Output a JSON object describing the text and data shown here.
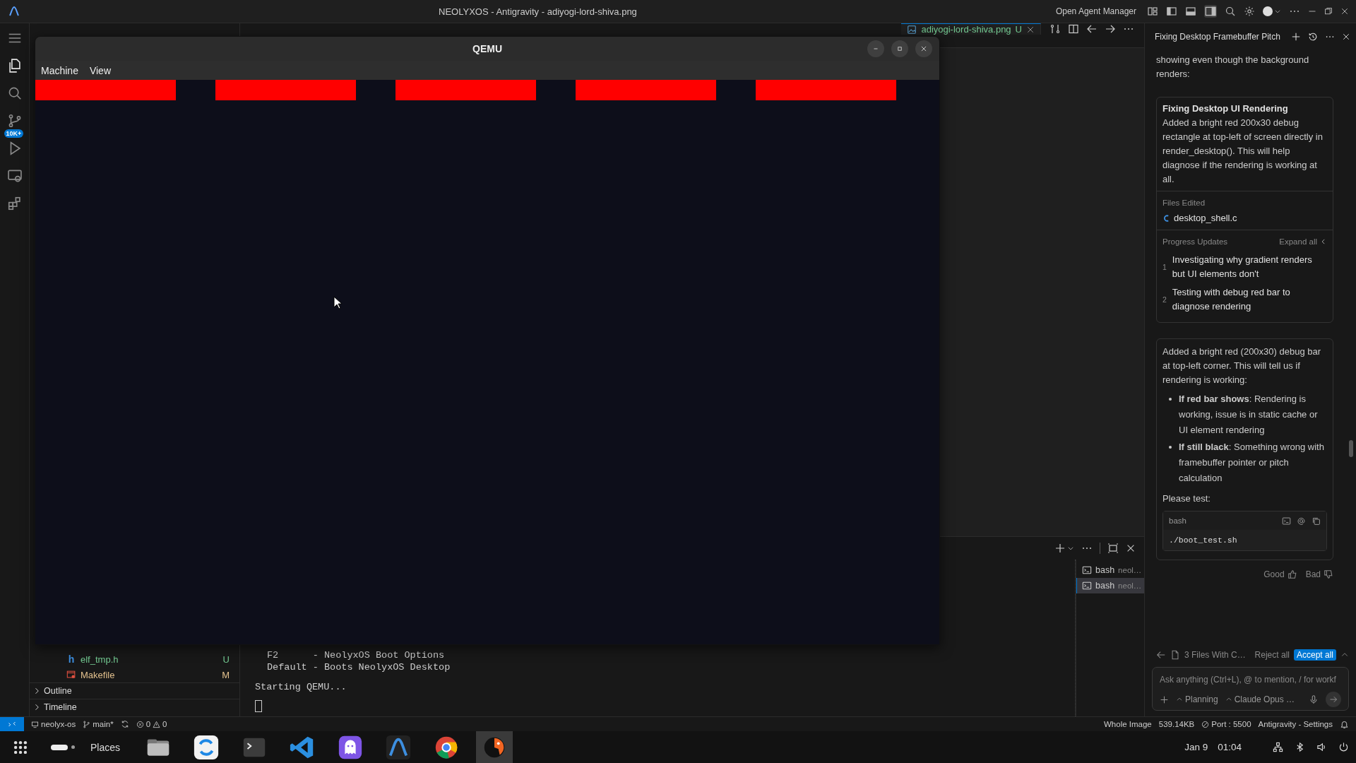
{
  "title_bar": {
    "title": "NEOLYXOS - Antigravity - adiyogi-lord-shiva.png",
    "agent_manager": "Open Agent Manager"
  },
  "activity_bar": {
    "badge": "10K+"
  },
  "editor_tabs": [
    {
      "label": "adiyogi-lord-shiva.png",
      "status": "U",
      "selected": true
    }
  ],
  "explorer": {
    "files": [
      {
        "name": "elf_tmp.h",
        "status": "U",
        "color": "#73c991",
        "kind": "header",
        "glyph": "h"
      },
      {
        "name": "Makefile",
        "status": "M",
        "color": "#e2c08d",
        "kind": "makefile"
      }
    ],
    "sections": [
      {
        "label": "Outline",
        "expanded": false
      },
      {
        "label": "Timeline",
        "expanded": false
      }
    ]
  },
  "qemu": {
    "title": "QEMU",
    "menu": [
      "Machine",
      "View"
    ]
  },
  "terminal": {
    "boot_menu": [
      "F2      - NeolyxOS Boot Options",
      "Default - Boots NeolyxOS Desktop"
    ],
    "status_line": "Starting QEMU...",
    "sessions": [
      {
        "name": "bash",
        "detail": "neol…",
        "selected": false
      },
      {
        "name": "bash",
        "detail": "neol…",
        "selected": true
      }
    ]
  },
  "chat": {
    "title": "Fixing Desktop Framebuffer Pitch",
    "intro": "showing even though the background renders:",
    "task": {
      "title": "Fixing Desktop UI Rendering",
      "summary": "Added a bright red 200x30 debug rectangle at top-left of screen directly in render_desktop(). This will help diagnose if the rendering is working at all.",
      "files_heading": "Files Edited",
      "files": [
        "desktop_shell.c"
      ],
      "progress_heading": "Progress Updates",
      "expand": "Expand all",
      "steps": [
        {
          "number": "1",
          "text": "Investigating why gradient renders but UI elements don't"
        },
        {
          "number": "2",
          "text": "Testing with debug red bar to diagnose rendering"
        }
      ]
    },
    "reply": {
      "text": "Added a bright red (200x30) debug bar at top-left corner. This will tell us if rendering is working:",
      "bullets": [
        "**If red bar shows**: Rendering is working, issue is in static cache or UI element rendering",
        "**If still black**: Something wrong with framebuffer pointer or pitch calculation"
      ],
      "prompt": "Please test:",
      "code": {
        "language": "bash",
        "text": "./boot_test.sh"
      }
    },
    "feedback": {
      "good": "Good",
      "bad": "Bad"
    },
    "changes": {
      "summary": "3 Files With C…",
      "reject": "Reject all",
      "accept": "Accept all"
    },
    "input": {
      "placeholder": "Ask anything (Ctrl+L), @ to mention, / for workf",
      "mode": "Planning",
      "model": "Claude Opus …"
    }
  },
  "status_bar": {
    "workspace": "neolyx-os",
    "branch": "main*",
    "errors": "0",
    "warnings": "0",
    "right": [
      {
        "text": "Whole Image",
        "kind": "plain"
      },
      {
        "text": "539.14KB",
        "kind": "plain"
      },
      {
        "text": "Port : 5500",
        "kind": "port"
      },
      {
        "text": "Antigravity - Settings",
        "kind": "plain"
      }
    ]
  },
  "taskbar": {
    "places": "Places",
    "apps": [
      {
        "kind": "files",
        "selected": false
      },
      {
        "kind": "sync",
        "selected": false
      },
      {
        "kind": "terminal",
        "selected": false
      },
      {
        "kind": "code",
        "selected": false
      },
      {
        "kind": "ghost",
        "selected": false
      },
      {
        "kind": "antigravity",
        "selected": false
      },
      {
        "kind": "browser",
        "selected": false
      },
      {
        "kind": "qemu",
        "selected": true
      }
    ],
    "date": "Jan 9",
    "time": "01:04"
  }
}
